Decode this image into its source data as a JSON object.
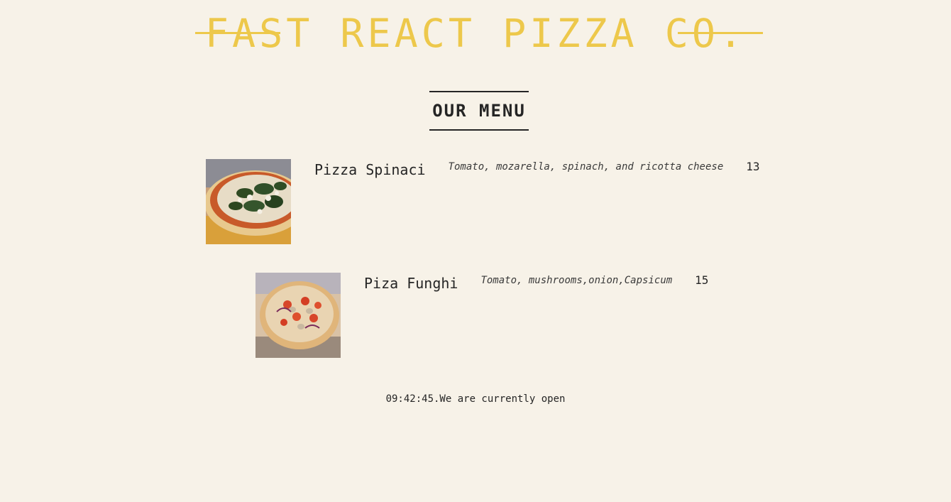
{
  "header": {
    "title": "FAST REACT PIZZA CO."
  },
  "menu": {
    "heading": "OUR MENU",
    "pizzas": [
      {
        "name": "Pizza Spinaci",
        "ingredients": "Tomato, mozarella, spinach, and ricotta cheese",
        "price": "13"
      },
      {
        "name": "Piza Funghi",
        "ingredients": "Tomato, mushrooms,onion,Capsicum",
        "price": "15"
      }
    ]
  },
  "footer": {
    "status": "09:42:45.We are currently open"
  },
  "colors": {
    "background": "#f7f2e8",
    "accent": "#edc84b",
    "text": "#252525"
  }
}
